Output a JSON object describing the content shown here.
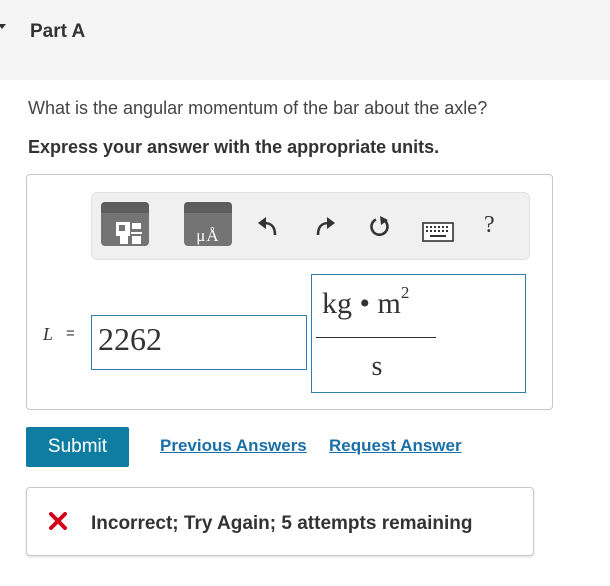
{
  "part": {
    "title": "Part A"
  },
  "question": "What is the angular momentum of the bar about the axle?",
  "instruction": "Express your answer with the appropriate units.",
  "toolbar": {
    "templates_icon": "templates-icon",
    "units_label": "μÅ",
    "undo_icon": "undo-icon",
    "redo_icon": "redo-icon",
    "reset_icon": "reset-icon",
    "keyboard_icon": "keyboard-icon",
    "help_label": "?"
  },
  "answer": {
    "variable": "L",
    "equals": "=",
    "value": "2262",
    "units_numerator": "kg • m",
    "units_exponent": "2",
    "units_denominator": "s"
  },
  "actions": {
    "submit_label": "Submit",
    "previous_answers": "Previous Answers",
    "request_answer": "Request Answer"
  },
  "feedback": {
    "icon": "x-mark-icon",
    "message": "Incorrect; Try Again; 5 attempts remaining",
    "status_color": "#d0021b"
  },
  "colors": {
    "accent": "#0f7da1",
    "link": "#1b6fa8",
    "input_border": "#2e7fa8"
  }
}
